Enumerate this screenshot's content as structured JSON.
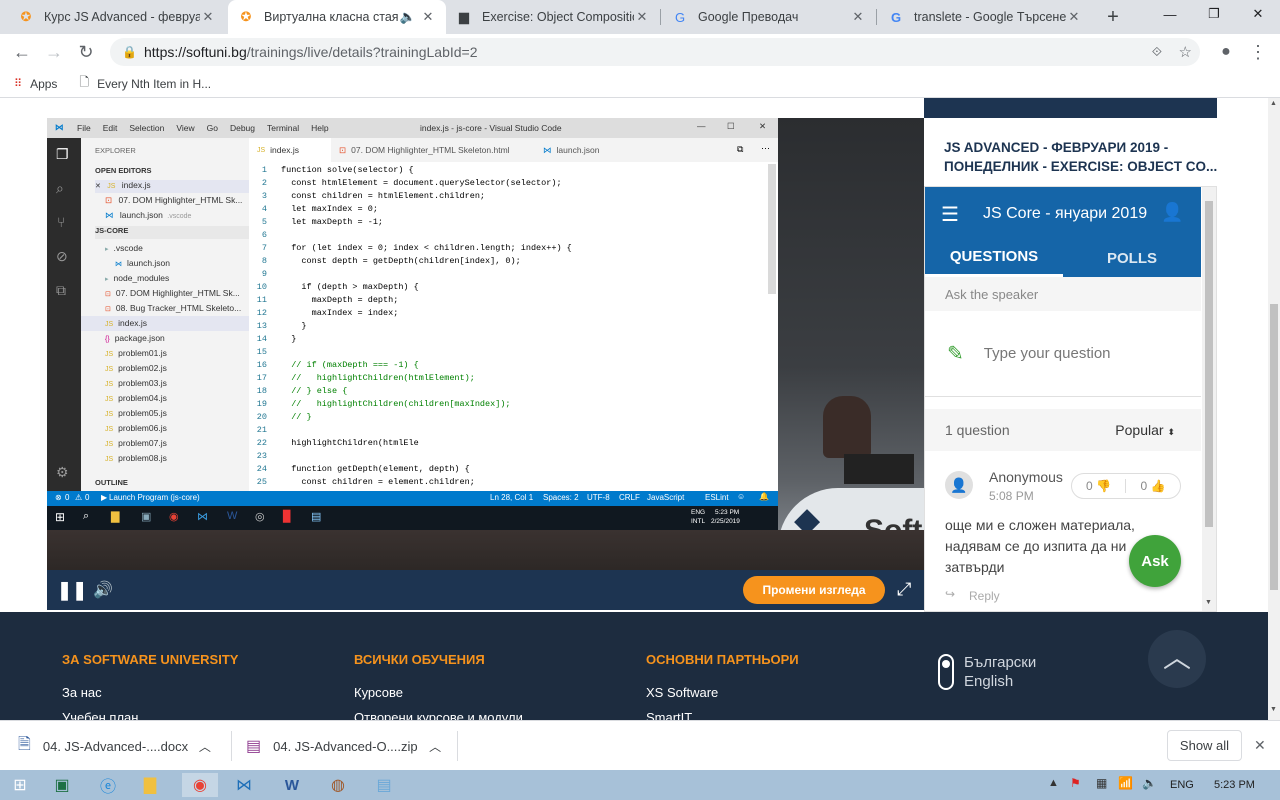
{
  "browser": {
    "tabs": [
      {
        "title": "Курс JS Advanced - февруар",
        "active": false
      },
      {
        "title": "Виртуална класна стая",
        "active": true
      },
      {
        "title": "Exercise: Object Compositio",
        "active": false
      },
      {
        "title": "Google Преводач",
        "active": false
      },
      {
        "title": "translete - Google Търсене",
        "active": false
      }
    ],
    "url_host": "https://softuni.bg",
    "url_path": "/trainings/live/details?trainingLabId=2",
    "bookmarks": {
      "apps": "Apps",
      "item1": "Every Nth Item in H..."
    }
  },
  "vscode": {
    "title": "index.js - js-core - Visual Studio Code",
    "menu": [
      "File",
      "Edit",
      "Selection",
      "View",
      "Go",
      "Debug",
      "Terminal",
      "Help"
    ],
    "explorer_label": "EXPLORER",
    "open_editors_label": "OPEN EDITORS",
    "open_editors": [
      "index.js",
      "07. DOM Highlighter_HTML Sk...",
      "launch.json"
    ],
    "launch_hint": ".vscode",
    "project_label": "JS-CORE",
    "tree": [
      ".vscode",
      "launch.json",
      "node_modules",
      "07. DOM Highlighter_HTML Sk...",
      "08. Bug Tracker_HTML Skeleto...",
      "index.js",
      "package.json",
      "problem01.js",
      "problem02.js",
      "problem03.js",
      "problem04.js",
      "problem05.js",
      "problem06.js",
      "problem07.js",
      "problem08.js"
    ],
    "outline_label": "OUTLINE",
    "editor_tabs": [
      "index.js",
      "07. DOM Highlighter_HTML Skeleton.html",
      "launch.json"
    ],
    "code": [
      "function solve(selector) {",
      "  const htmlElement = document.querySelector(selector);",
      "  const children = htmlElement.children;",
      "  let maxIndex = 0;",
      "  let maxDepth = -1;",
      "",
      "  for (let index = 0; index < children.length; index++) {",
      "    const depth = getDepth(children[index], 0);",
      "",
      "    if (depth > maxDepth) {",
      "      maxDepth = depth;",
      "      maxIndex = index;",
      "    }",
      "  }",
      "",
      "  // if (maxDepth === -1) {",
      "  //   highlightChildren(htmlElement);",
      "  // } else {",
      "  //   highlightChildren(children[maxIndex]);",
      "  // }",
      "",
      "  highlightChildren(htmlEle",
      "",
      "  function getDepth(element, depth) {",
      "    const children = element.children;"
    ],
    "status_left": "Launch Program (js-core)",
    "status_errors": "0",
    "status_warnings": "0",
    "status_right": [
      "Ln 28, Col 1",
      "Spaces: 2",
      "UTF-8",
      "CRLF",
      "JavaScript",
      "ESLint"
    ],
    "clock_time": "5:23 PM",
    "clock_date": "2/25/2019",
    "lang1": "ENG",
    "lang2": "INTL"
  },
  "player": {
    "change_view": "Промени изгледа",
    "watermark": "Soft"
  },
  "sidebar": {
    "title": "JS ADVANCED - ФЕВРУАРИ 2019 - ПОНЕДЕЛНИК - EXERCISE: OBJECT CO...",
    "slido_event": "JS Core - януари 2019",
    "tab_questions": "QUESTIONS",
    "tab_polls": "POLLS",
    "ask_label": "Ask the speaker",
    "type_placeholder": "Type your question",
    "count_label": "1 question",
    "sort_label": "Popular",
    "question": {
      "author": "Anonymous",
      "time": "5:08 PM",
      "dislikes": "0",
      "likes": "0",
      "text": "още ми е сложен материала, надявам се до изпита да ни затвърди",
      "reply": "Reply"
    },
    "ask_button": "Ask"
  },
  "footer": {
    "col1_title": "ЗА SOFTWARE UNIVERSITY",
    "col1_items": [
      "За нас",
      "Учебен план"
    ],
    "col2_title": "ВСИЧКИ ОБУЧЕНИЯ",
    "col2_items": [
      "Курсове",
      "Отворени курсове и модули"
    ],
    "col3_title": "ОСНОВНИ ПАРТНЬОРИ",
    "col3_items": [
      "XS Software",
      "SmartIT"
    ],
    "lang_bg": "Български",
    "lang_en": "English"
  },
  "downloads": {
    "items": [
      "04. JS-Advanced-....docx",
      "04. JS-Advanced-O....zip"
    ],
    "show_all": "Show all"
  },
  "taskbar": {
    "lang": "ENG",
    "time": "5:23 PM"
  },
  "colors": {
    "accent": "#f6931d",
    "slido_blue": "#1565a8",
    "footer_bg": "#1d2c3f"
  }
}
